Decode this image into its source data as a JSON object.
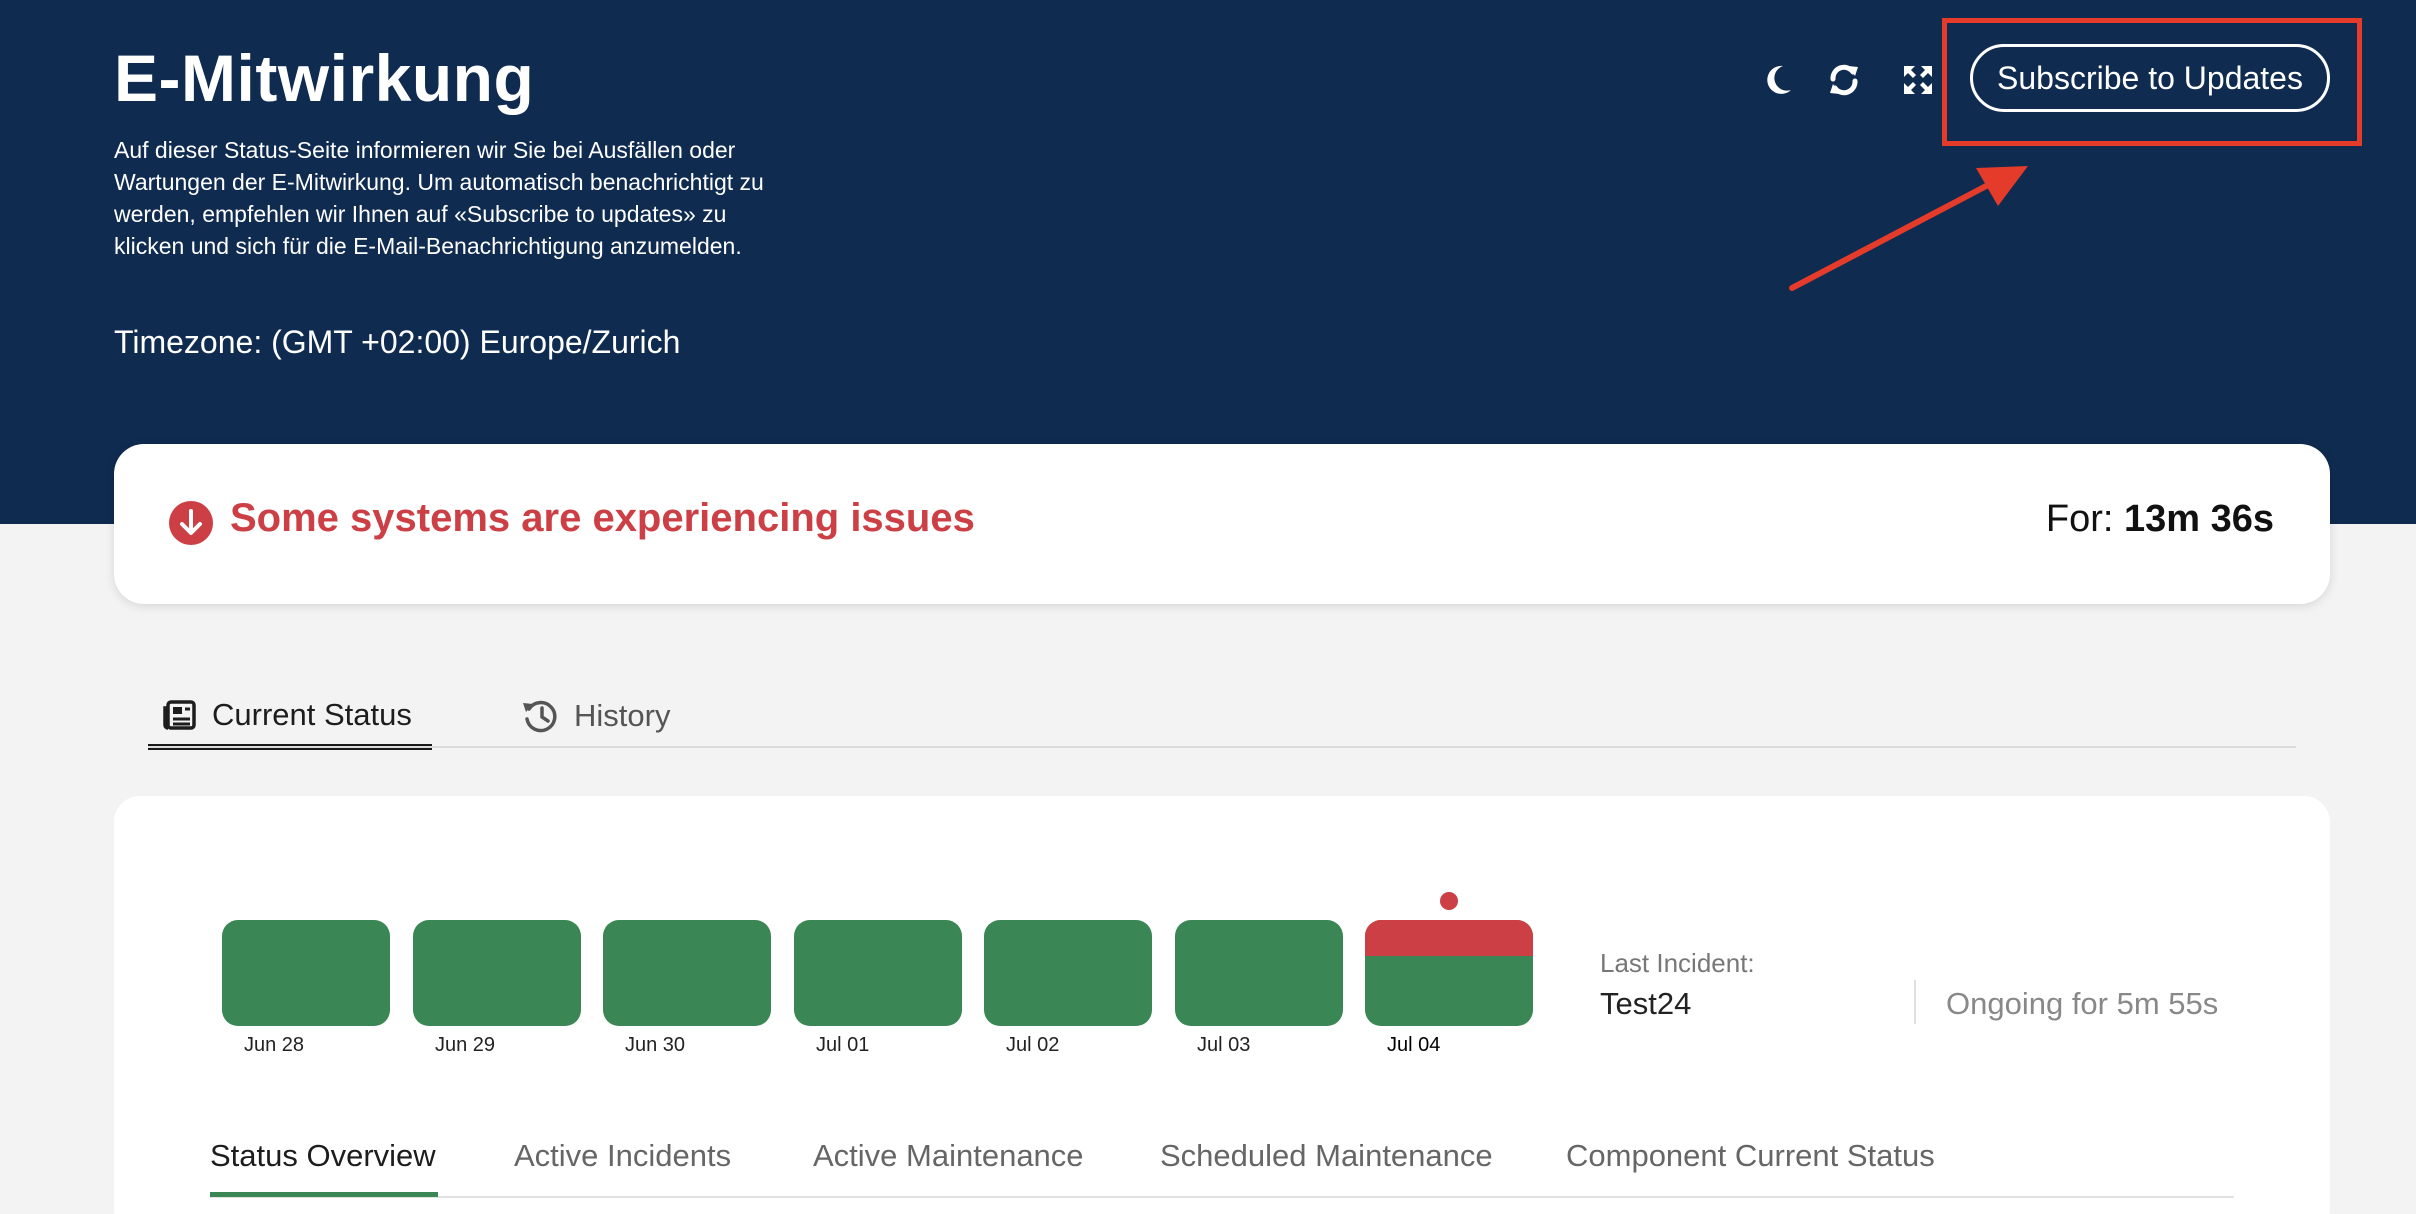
{
  "header": {
    "title": "E-Mitwirkung",
    "description": "Auf dieser Status-Seite informieren wir Sie bei Ausfällen oder Wartungen der E-Mitwirkung. Um automatisch benachrichtigt zu werden, empfehlen wir Ihnen auf «Subscribe to updates» zu klicken und sich für die E-Mail-Benachrichtigung anzumelden.",
    "timezone": "Timezone: (GMT +02:00) Europe/Zurich",
    "icons": [
      "moon-icon",
      "refresh-icon",
      "fullscreen-icon"
    ],
    "subscribe_label": "Subscribe to Updates",
    "background_color": "#0f2b50"
  },
  "banner": {
    "message": "Some systems are experiencing issues",
    "for_label": "For:",
    "duration": "13m 36s",
    "status_color": "#cc3f45",
    "icon": "arrow-down-circle-icon"
  },
  "tabs": [
    {
      "label": "Current Status",
      "icon": "newspaper-icon",
      "active": true
    },
    {
      "label": "History",
      "icon": "history-icon",
      "active": false
    }
  ],
  "timeline": {
    "days": [
      {
        "label": "Jun 28",
        "status": "operational"
      },
      {
        "label": "Jun 29",
        "status": "operational"
      },
      {
        "label": "Jun 30",
        "status": "operational"
      },
      {
        "label": "Jul 01",
        "status": "operational"
      },
      {
        "label": "Jul 02",
        "status": "operational"
      },
      {
        "label": "Jul 03",
        "status": "operational"
      },
      {
        "label": "Jul 04",
        "status": "incident"
      }
    ],
    "operational_color": "#3a8755",
    "incident_color": "#cc3f45"
  },
  "last_incident": {
    "label": "Last Incident:",
    "name": "Test24",
    "ongoing": "Ongoing for 5m 55s"
  },
  "subtabs": [
    {
      "label": "Status Overview",
      "active": true
    },
    {
      "label": "Active Incidents",
      "active": false
    },
    {
      "label": "Active Maintenance",
      "active": false
    },
    {
      "label": "Scheduled Maintenance",
      "active": false
    },
    {
      "label": "Component Current Status",
      "active": false
    }
  ]
}
